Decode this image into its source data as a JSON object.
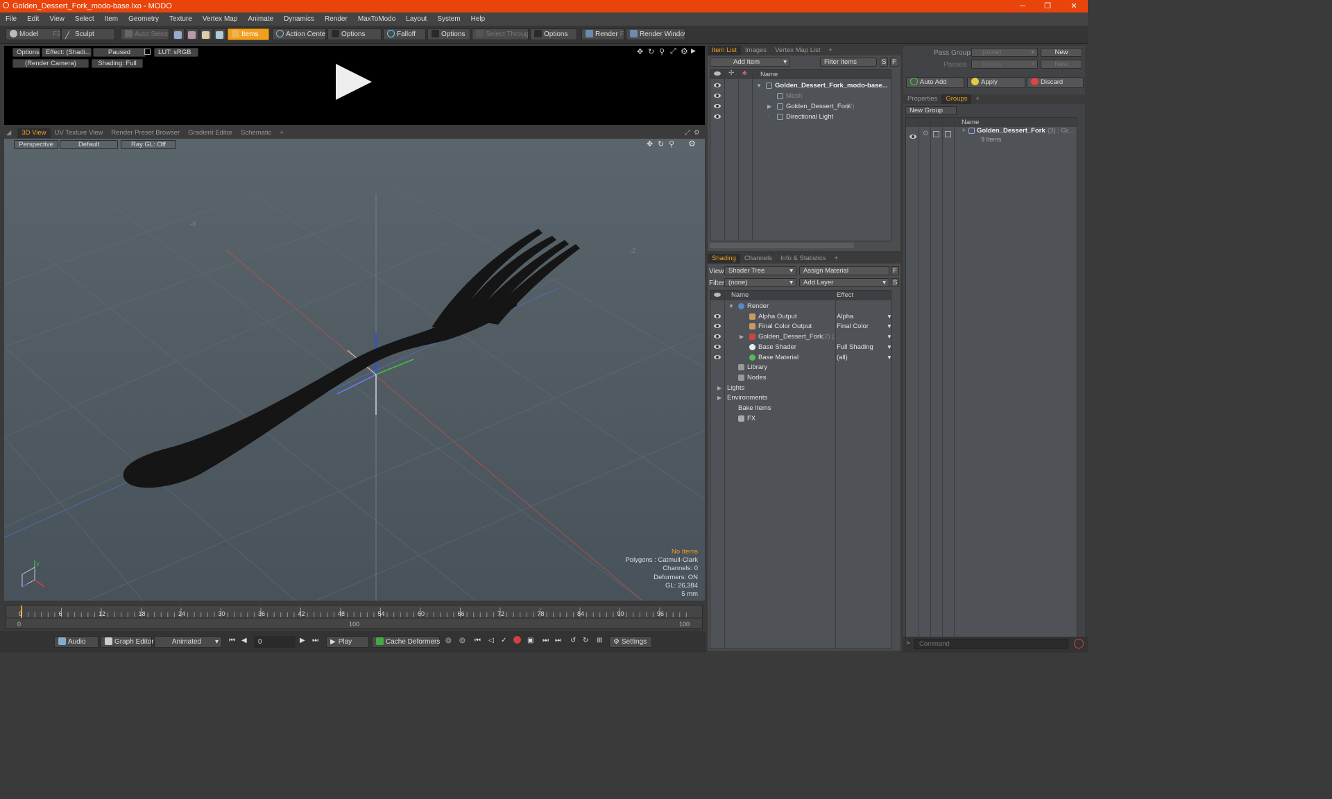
{
  "window": {
    "title": "Golden_Dessert_Fork_modo-base.lxo - MODO",
    "minimize": "─",
    "maximize": "❐",
    "close": "✕"
  },
  "menu": [
    "File",
    "Edit",
    "View",
    "Select",
    "Item",
    "Geometry",
    "Texture",
    "Vertex Map",
    "Animate",
    "Dynamics",
    "Render",
    "MaxToModo",
    "Layout",
    "System",
    "Help"
  ],
  "toolbar": {
    "model": "Model",
    "model_key": "F2",
    "sculpt": "Sculpt",
    "auto_select": "Auto Select",
    "items": "Items",
    "action_center": "Action Center",
    "options1": "Options",
    "falloff": "Falloff",
    "options2": "Options",
    "select_through": "Select Through",
    "options3": "Options",
    "render": "Render",
    "render_key": "F9",
    "render_window": "Render Window"
  },
  "preview": {
    "options": "Options",
    "effect": "Effect: (Shadi...",
    "paused": "Paused",
    "lut": "LUT: sRGB",
    "camera": "(Render Camera)",
    "shading": "Shading: Full"
  },
  "viewport_tabs": [
    "3D View",
    "UV Texture View",
    "Render Preset Browser",
    "Gradient Editor",
    "Schematic",
    "+"
  ],
  "viewport": {
    "perspective": "Perspective",
    "default": "Default",
    "raygl": "Ray GL: Off",
    "axis_x": "-X",
    "axis_z": "-Z",
    "gizmo_y": "Y",
    "info": {
      "no_items": "No Items",
      "polygons": "Polygons : Catmull-Clark",
      "channels": "Channels: 0",
      "deformers": "Deformers: ON",
      "gl": "GL: 26,384",
      "units": "5 mm"
    }
  },
  "timeline": {
    "ticks": [
      "0",
      "6",
      "12",
      "18",
      "24",
      "30",
      "36",
      "42",
      "48",
      "54",
      "60",
      "66",
      "72",
      "78",
      "84",
      "90",
      "96"
    ],
    "start": "0",
    "mid": "100",
    "end": "100"
  },
  "bottombar": {
    "audio": "Audio",
    "graph_editor": "Graph Editor",
    "animated": "Animated",
    "frame": "0",
    "play": "Play",
    "cache_deformers": "Cache Deformers",
    "settings": "Settings"
  },
  "itemlist": {
    "tabs": [
      "Item List",
      "Images",
      "Vertex Map List",
      "+"
    ],
    "add_item": "Add Item",
    "filter_items": "Filter Items",
    "s": "S",
    "f": "F",
    "col_name": "Name",
    "rows": [
      {
        "label": "Golden_Dessert_Fork_modo-base...",
        "count": ""
      },
      {
        "label": "Mesh",
        "count": ""
      },
      {
        "label": "Golden_Dessert_Fork",
        "count": "(2)"
      },
      {
        "label": "Directional Light",
        "count": ""
      }
    ]
  },
  "shading": {
    "tabs": [
      "Shading",
      "Channels",
      "Info & Statistics",
      "+"
    ],
    "view_label": "View",
    "view_value": "Shader Tree",
    "assign_material": "Assign Material",
    "f": "F",
    "filter_label": "Filter",
    "filter_value": "(none)",
    "add_layer": "Add Layer",
    "s": "S",
    "col_name": "Name",
    "col_effect": "Effect",
    "rows": [
      {
        "label": "Render",
        "count": "",
        "effect": ""
      },
      {
        "label": "Alpha Output",
        "count": "",
        "effect": "Alpha"
      },
      {
        "label": "Final Color Output",
        "count": "",
        "effect": "Final Color"
      },
      {
        "label": "Golden_Dessert_Fork",
        "count": "(2) (...",
        "effect": ""
      },
      {
        "label": "Base Shader",
        "count": "",
        "effect": "Full Shading"
      },
      {
        "label": "Base Material",
        "count": "",
        "effect": "(all)"
      },
      {
        "label": "Library",
        "count": "",
        "effect": ""
      },
      {
        "label": "Nodes",
        "count": "",
        "effect": ""
      },
      {
        "label": "Lights",
        "count": "",
        "effect": ""
      },
      {
        "label": "Environments",
        "count": "",
        "effect": ""
      },
      {
        "label": "Bake Items",
        "count": "",
        "effect": ""
      },
      {
        "label": "FX",
        "count": "",
        "effect": ""
      }
    ]
  },
  "groups": {
    "pass_groups_label": "Pass Groups",
    "pass_groups_value": "(none)",
    "new": "New",
    "passes_label": "Passes",
    "passes_value": "(none)",
    "new2": "New",
    "auto_add": "Auto Add",
    "apply": "Apply",
    "discard": "Discard",
    "tabs": [
      "Properties",
      "Groups",
      "+"
    ],
    "new_group": "New Group",
    "col_name": "Name",
    "group_name": "Golden_Dessert_Fork",
    "group_meta": "(3) : Gr...",
    "group_items": "9 Items"
  },
  "command": {
    "placeholder": "Command"
  }
}
